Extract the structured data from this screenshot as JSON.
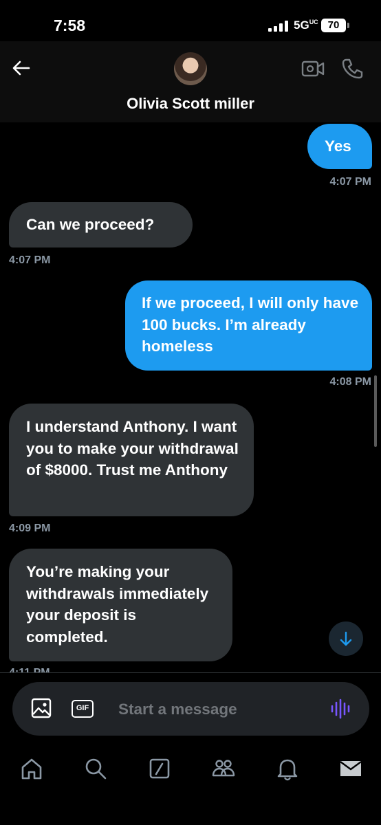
{
  "status_bar": {
    "time": "7:58",
    "network": "5G",
    "network_sub": "UC",
    "battery": "70"
  },
  "header": {
    "contact_name": "Olivia Scott miller"
  },
  "messages": [
    {
      "direction": "out",
      "text": "Yes",
      "time": "4:07 PM"
    },
    {
      "direction": "in",
      "text": "Can we proceed?",
      "time": "4:07 PM"
    },
    {
      "direction": "out",
      "text": "If we proceed, I will only have 100 bucks. I’m already homeless",
      "time": "4:08 PM"
    },
    {
      "direction": "in",
      "text": "I understand Anthony. I want you to make your withdrawal of $8000. Trust me Anthony",
      "time": "4:09 PM"
    },
    {
      "direction": "in",
      "text": "You’re making your withdrawals immediately your deposit is completed.",
      "time": "4:11 PM"
    }
  ],
  "composer": {
    "placeholder": "Start a message",
    "gif_label": "GIF"
  },
  "colors": {
    "accent": "#1d9bf0",
    "incoming_bubble": "#2f3336",
    "mic": "#7856ff"
  },
  "nav": [
    "home-icon",
    "search-icon",
    "grok-icon",
    "communities-icon",
    "notifications-icon",
    "messages-icon"
  ]
}
